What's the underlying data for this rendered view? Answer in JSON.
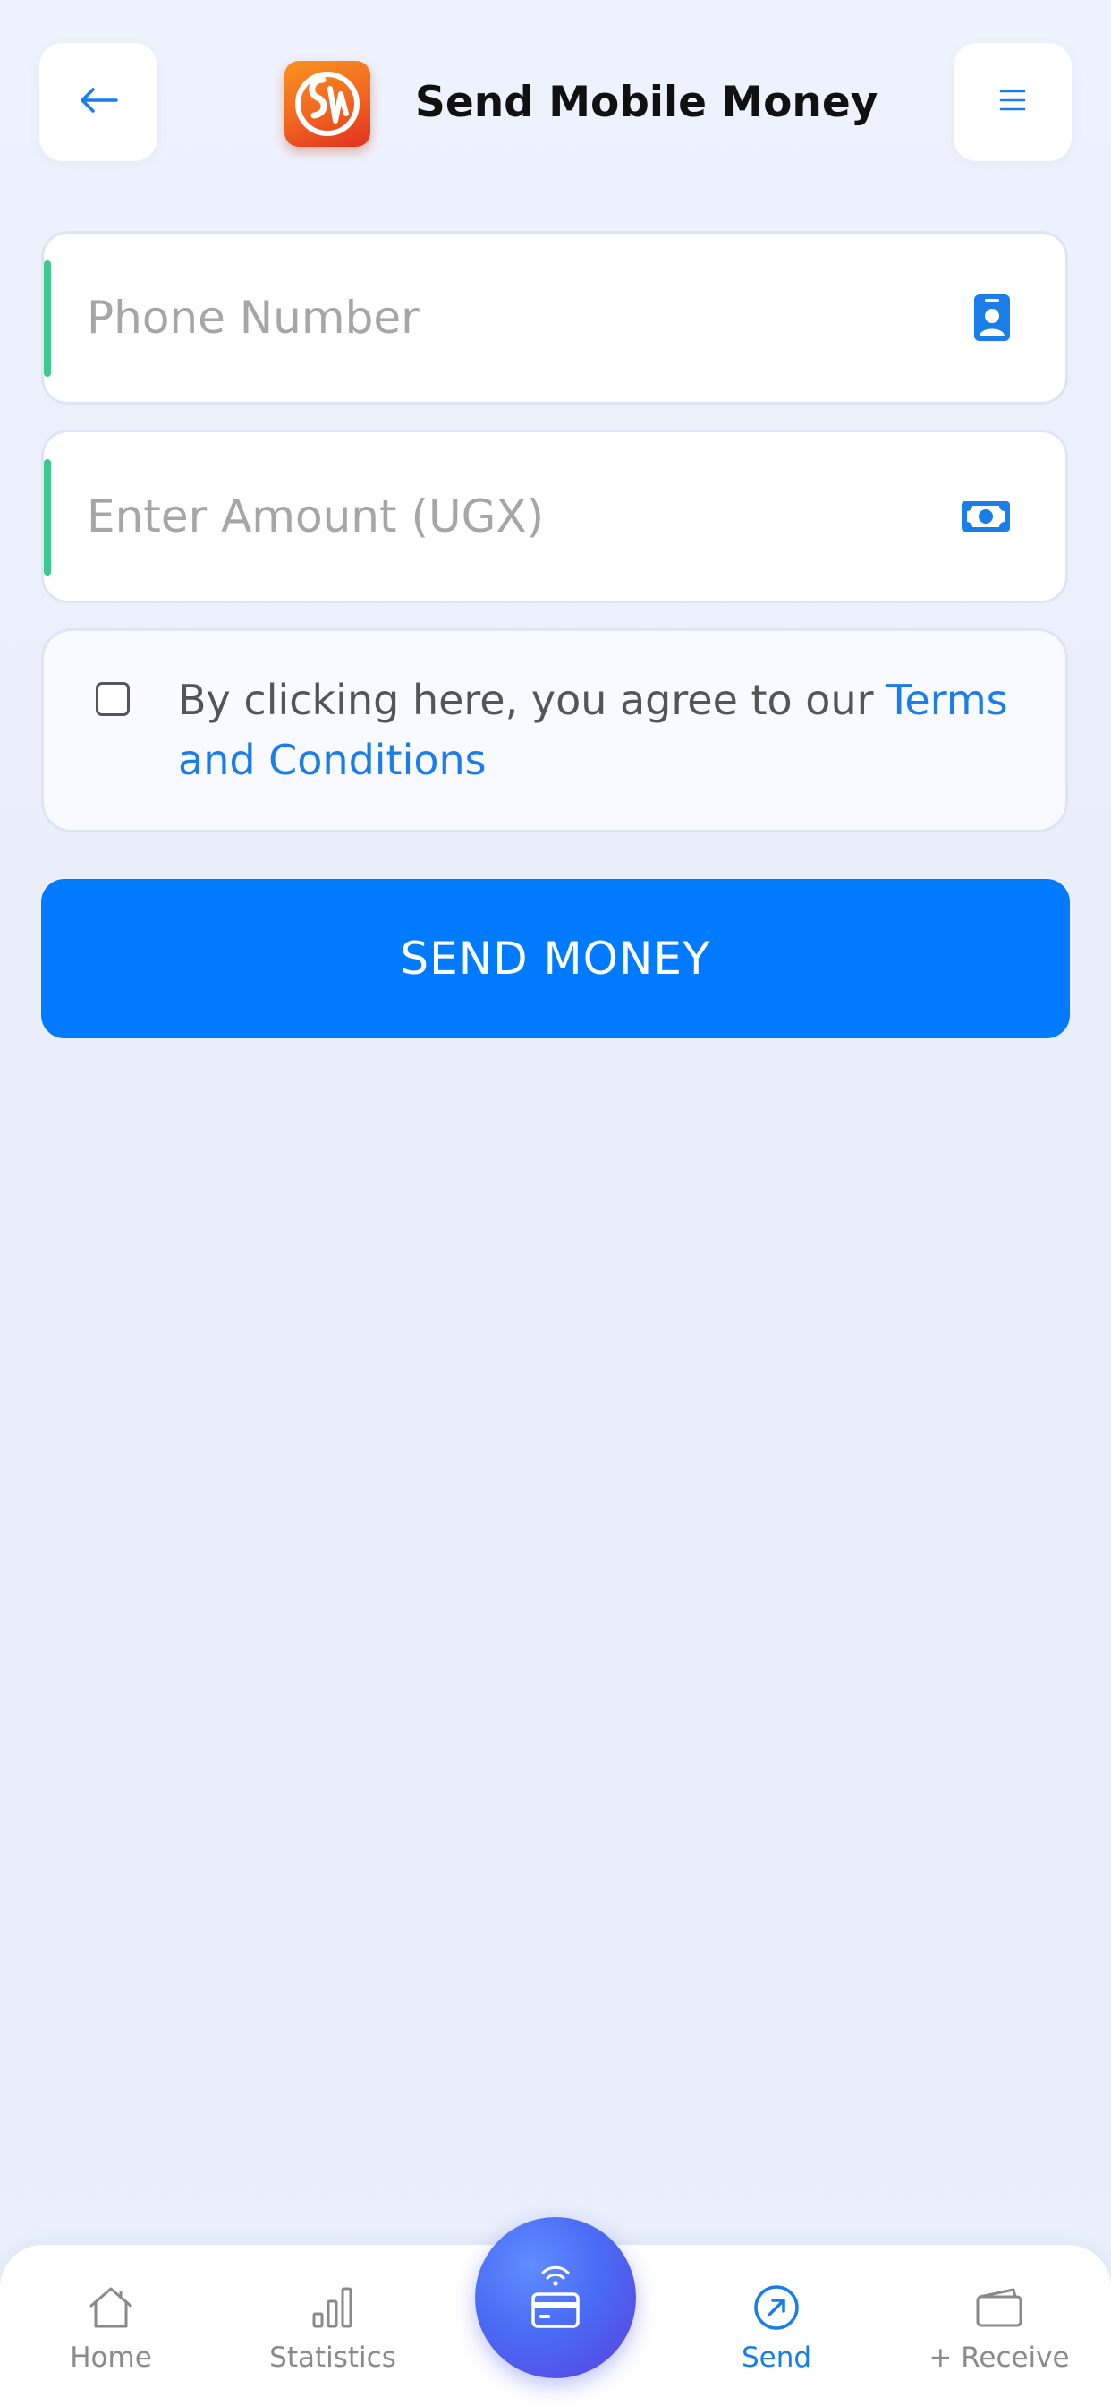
{
  "header": {
    "title": "Send Mobile Money",
    "back_icon": "arrow-left-icon",
    "menu_icon": "hamburger-menu-icon",
    "logo_icon": "sw-brand-logo"
  },
  "form": {
    "phone": {
      "placeholder": "Phone Number",
      "value": "",
      "icon": "contact-card-icon"
    },
    "amount": {
      "placeholder": "Enter Amount (UGX)",
      "value": "",
      "icon": "cash-note-icon"
    },
    "terms": {
      "checked": false,
      "text": "By clicking here, you agree to our ",
      "link_text": "Terms and Conditions"
    },
    "submit_label": "SEND MONEY"
  },
  "nav": {
    "items": [
      {
        "label": "Home",
        "icon": "home-icon",
        "active": false
      },
      {
        "label": "Statistics",
        "icon": "bar-chart-icon",
        "active": false
      },
      {
        "label": "Send",
        "icon": "arrow-up-right-circle-icon",
        "active": true
      },
      {
        "label": "+ Receive",
        "icon": "wallet-icon",
        "active": false
      }
    ],
    "fab_icon": "contactless-card-icon"
  },
  "colors": {
    "primary": "#007bff",
    "accent_green": "#3cc98e",
    "link": "#1a7de8",
    "logo_orange": "#f26522",
    "fab_purple": "#5a3fe0"
  }
}
